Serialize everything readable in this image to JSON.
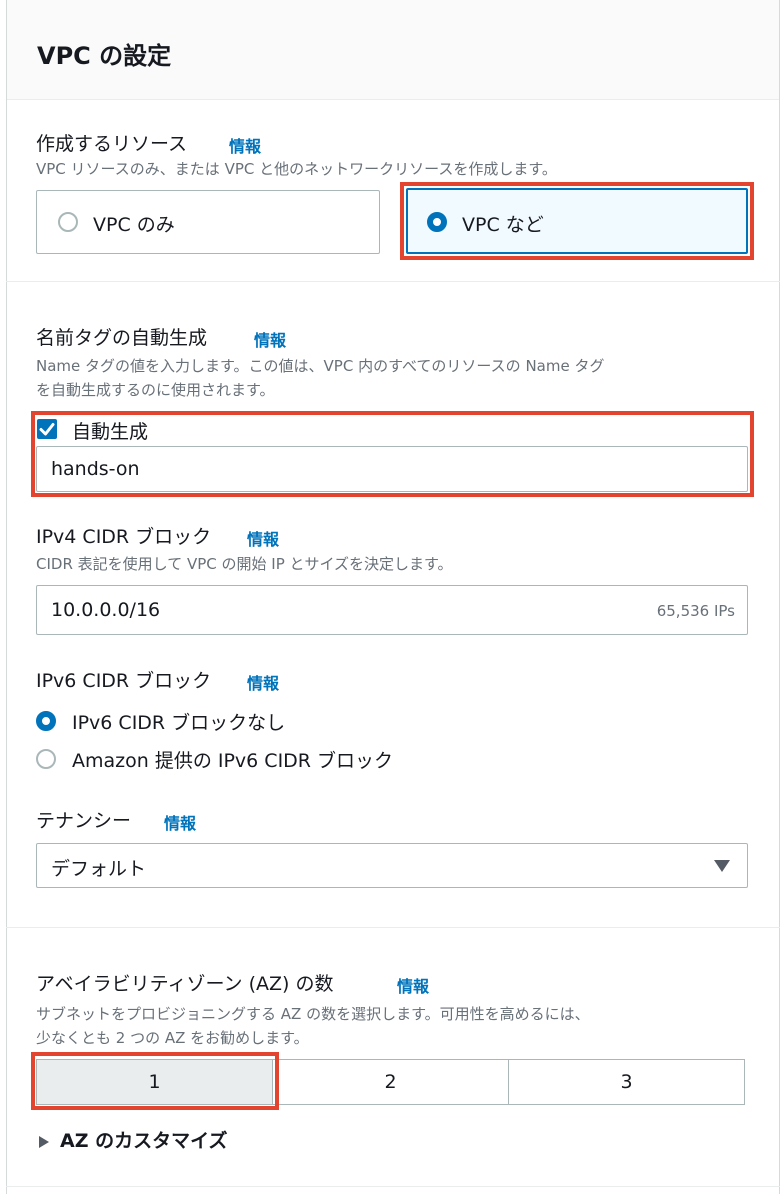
{
  "panel": {
    "title": "VPC の設定"
  },
  "resources": {
    "label": "作成するリソース",
    "info": "情報",
    "description": "VPC リソースのみ、または VPC と他のネットワークリソースを作成します。",
    "options": [
      "VPC のみ",
      "VPC など"
    ],
    "selected": "VPC など"
  },
  "name_tag": {
    "label": "名前タグの自動生成",
    "info": "情報",
    "description_line1": "Name タグの値を入力します。この値は、VPC 内のすべてのリソースの Name タグ",
    "description_line2": "を自動生成するのに使用されます。",
    "checkbox_label": "自動生成",
    "checked": true,
    "value": "hands-on"
  },
  "ipv4": {
    "label": "IPv4 CIDR ブロック",
    "info": "情報",
    "description": "CIDR 表記を使用して VPC の開始 IP とサイズを決定します。",
    "value": "10.0.0.0/16",
    "suffix": "65,536 IPs"
  },
  "ipv6": {
    "label": "IPv6 CIDR ブロック",
    "info": "情報",
    "options": [
      "IPv6 CIDR ブロックなし",
      "Amazon 提供の IPv6 CIDR ブロック"
    ],
    "selected": "IPv6 CIDR ブロックなし"
  },
  "tenancy": {
    "label": "テナンシー",
    "info": "情報",
    "value": "デフォルト"
  },
  "az": {
    "label": "アベイラビリティゾーン (AZ) の数",
    "info": "情報",
    "description_line1": "サブネットをプロビジョニングする AZ の数を選択します。可用性を高めるには、",
    "description_line2": "少なくとも 2 つの AZ をお勧めします。",
    "options": [
      "1",
      "2",
      "3"
    ],
    "selected": "1",
    "customize": "AZ のカスタマイズ"
  },
  "colors": {
    "accent": "#0073bb",
    "highlight": "#e2442f",
    "border": "#aab7b8",
    "muted_text": "#687078"
  }
}
